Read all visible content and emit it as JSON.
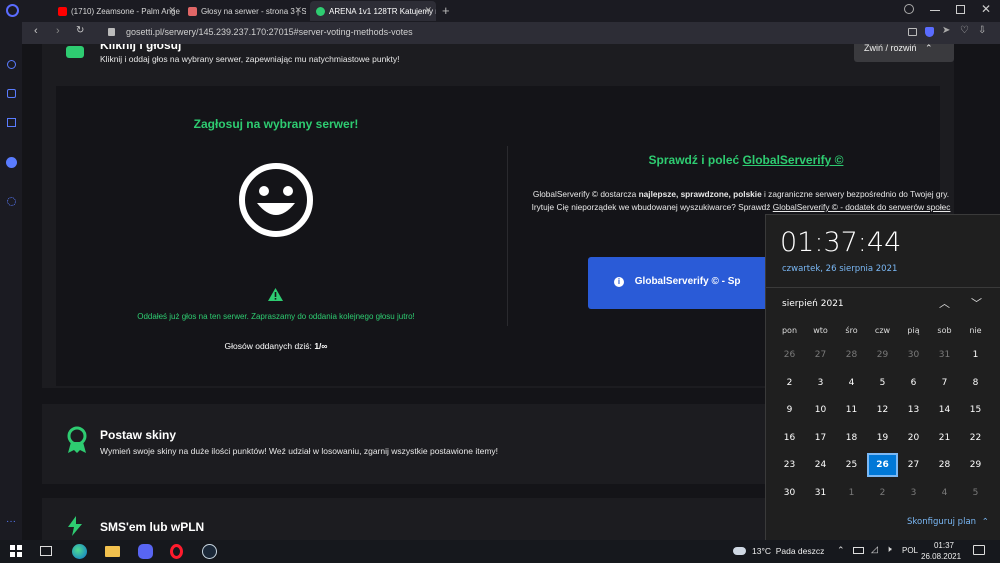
{
  "browser": {
    "tabs": [
      {
        "title": "(1710) Zeamsone - Palm Angels (Of",
        "favicon_color": "#ff0000"
      },
      {
        "title": "Głosy na serwer - strona 3 | Serwer",
        "favicon_color": "#e06666"
      },
      {
        "title": "ARENA 1v1 128TR Katujemy ro",
        "favicon_color": "#2ecc71"
      }
    ],
    "new_tab": "+",
    "url": "gosetti.pl/serwery/145.239.237.170:27015#server-voting-methods-votes"
  },
  "section_vote": {
    "title_partial": "Kliknij i głosuj",
    "description": "Kliknij i oddaj głos na wybrany serwer, zapewniając mu natychmiastowe punkty!",
    "collapse_label": "Zwiń / rozwiń",
    "vote_heading": "Zagłosuj na wybrany serwer!",
    "notice": "Oddałeś już głos na ten serwer. Zapraszamy do oddania kolejnego głosu jutro!",
    "votes_today_label": "Głosów oddanych dziś:",
    "votes_today_value": "1/∞",
    "recommend_heading_prefix": "Sprawdź i poleć",
    "recommend_heading_link": "GlobalServerify ©",
    "recommend_text_1": "GlobalServerify © dostarcza",
    "recommend_bold": "najlepsze, sprawdzone, polskie",
    "recommend_text_2": "i zagraniczne serwery bezpośrednio do Twojej gry. Irytuje Cię nieporządek we wbudowanej wyszukiwarce? Sprawdź",
    "recommend_link": "GlobalServerify © - dodatek do serwerów społec",
    "recommend_button": "GlobalServerify © - Sp"
  },
  "section_skins": {
    "title": "Postaw skiny",
    "description": "Wymień swoje skiny na duże ilości punktów! Weź udział w losowaniu, zgarnij wszystkie postawione itemy!"
  },
  "section_sms": {
    "title": "SMS'em lub wPLN"
  },
  "calendar": {
    "time": "01:37:44",
    "date_long": "czwartek, 26 sierpnia 2021",
    "month_label": "sierpień 2021",
    "weekdays": [
      "pon",
      "wto",
      "śro",
      "czw",
      "pią",
      "sob",
      "nie"
    ],
    "weeks": [
      [
        "26",
        "27",
        "28",
        "29",
        "30",
        "31",
        "1"
      ],
      [
        "2",
        "3",
        "4",
        "5",
        "6",
        "7",
        "8"
      ],
      [
        "9",
        "10",
        "11",
        "12",
        "13",
        "14",
        "15"
      ],
      [
        "16",
        "17",
        "18",
        "19",
        "20",
        "21",
        "22"
      ],
      [
        "23",
        "24",
        "25",
        "26",
        "27",
        "28",
        "29"
      ],
      [
        "30",
        "31",
        "1",
        "2",
        "3",
        "4",
        "5"
      ]
    ],
    "today_cell": [
      4,
      3
    ],
    "configure_label": "Skonfiguruj plan"
  },
  "taskbar": {
    "weather": "13°C  Pada deszcz",
    "language": "POL",
    "clock_time": "01:37",
    "clock_date": "26.08.2021"
  }
}
